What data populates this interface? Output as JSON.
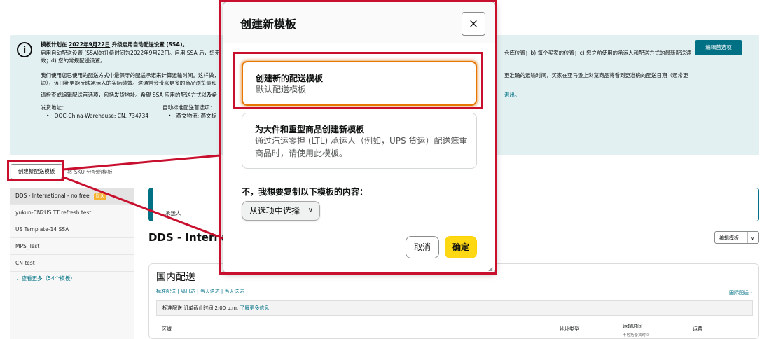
{
  "banner": {
    "line1_prefix": "模板计划在 ",
    "line1_date": "2022年9月22日",
    "line1_suffix": " 升级启用自动配送设置 (SSA)。",
    "line2": "启用自动配送设置 (SSA)的升级时间为2022年9月22日。启用 SSA 后，您无",
    "line2_right": "仓库位置；b) 每个买家的位置；c) 您之前使用的承运人和配送方式的最新配送速",
    "line3": "效；d) 您的常规配送设置。",
    "line4": "我们使用您已使用的配送方式中最保守的配送承诺来计算运输时间。这样做，",
    "line4_right": "更准确的运输时间，买家在亚马逊上浏览商品将看到更准确的配送日期（通常更",
    "line5": "短），该日期更能反映承运人的实际绩效。这通常会带来更多的商品浏览量和",
    "line6": "请检查或编辑配送首选项，包括发货地址。希望 SSA 应用的配送方式以及希",
    "line6_right": "退出。",
    "ship_from_label": "发货地址：",
    "ship_from_value": "OOC-China-Warehouse: CN, 734734",
    "auto_pref_label": "自动标准配送首选项：",
    "auto_pref_value": "燕文物流: 燕文标",
    "edit_prefs": "编辑首选项"
  },
  "toolbar": {
    "create_template": "创建新配送模板",
    "assign_sku": "将 SKU 分配给模板"
  },
  "sidebar": {
    "items": [
      {
        "label": "DDS - International - no free"
      },
      {
        "label": "yukun-CN2US TT refresh test"
      },
      {
        "label": "US Template-14 SSA"
      },
      {
        "label": "MPS_Test"
      },
      {
        "label": "CN test"
      }
    ],
    "default_badge": "默认",
    "more": "⌄ 查看更多（54个模板）"
  },
  "main": {
    "callout_text": "承运人",
    "template_title": "DDS - Internatio",
    "edit_template": "编辑模板",
    "domestic_title": "国内配送",
    "tabs_text": "标准配送 | 隔日达 | 当天送达 | 当天送达",
    "intl_link": "国际配送 ›",
    "std_header_prefix": "标准配送 订单截止时间 2:00 p.m. ",
    "std_header_link": "了解更多信息",
    "col_region": "区域",
    "col_address_type": "地址类型",
    "col_transit": "运输时间",
    "col_transit_sub": "不包括备货时间",
    "col_fee": "运费"
  },
  "modal": {
    "title": "创建新模板",
    "close": "×",
    "option1_title": "创建新的配送模板",
    "option1_desc": "默认配送模板",
    "option2_title": "为大件和重型商品创建新模板",
    "option2_desc": "通过汽运零担 (LTL) 承运人（例如，UPS 货运）配送笨重商品时，请使用此模板。",
    "copy_label": "不，我想要复制以下模板的内容：",
    "copy_select": "从选项中选择",
    "cancel": "取消",
    "confirm": "确定"
  },
  "colors": {
    "accent_teal": "#007185",
    "confirm_yellow": "#ffd814",
    "annotation_red": "#c8102e",
    "focus_orange": "#e77600"
  }
}
